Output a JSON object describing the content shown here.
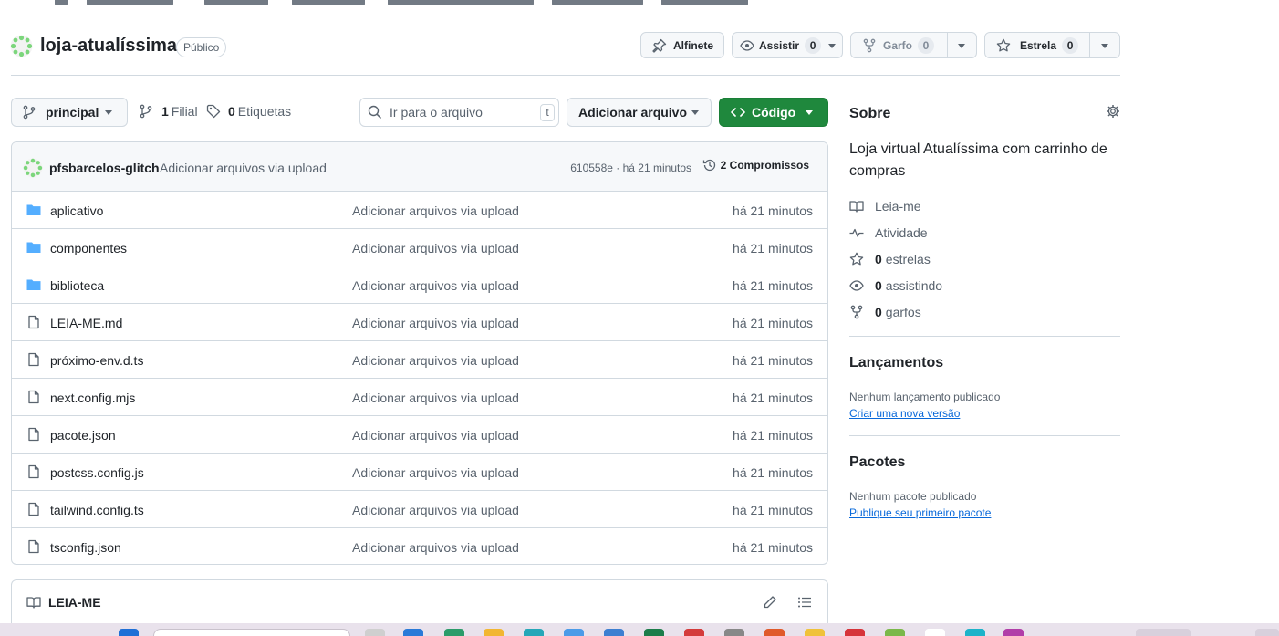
{
  "repo": {
    "name": "loja-atualíssima",
    "visibility": "Público"
  },
  "actions": {
    "pin_label": "Alfinete",
    "watch_label": "Assistir",
    "watch_count": "0",
    "fork_label": "Garfo",
    "fork_count": "0",
    "star_label": "Estrela",
    "star_count": "0"
  },
  "toolbar": {
    "branch": "principal",
    "branches_count": "1",
    "branches_label": "Filial",
    "tags_count": "0",
    "tags_label": "Etiquetas",
    "search_placeholder": "Ir para o arquivo",
    "search_kbd": "t",
    "add_file_label": "Adicionar arquivo",
    "code_label": "Código"
  },
  "commit": {
    "author": "pfsbarcelos-glitch",
    "message": "Adicionar arquivos via upload",
    "sha_time": "610558e · há 21 minutos",
    "count_label": "2 Compromissos"
  },
  "files": [
    {
      "type": "dir",
      "name": "aplicativo",
      "message": "Adicionar arquivos via upload",
      "time": "há 21 minutos"
    },
    {
      "type": "dir",
      "name": "componentes",
      "message": "Adicionar arquivos via upload",
      "time": "há 21 minutos"
    },
    {
      "type": "dir",
      "name": "biblioteca",
      "message": "Adicionar arquivos via upload",
      "time": "há 21 minutos"
    },
    {
      "type": "file",
      "name": "LEIA-ME.md",
      "message": "Adicionar arquivos via upload",
      "time": "há 21 minutos"
    },
    {
      "type": "file",
      "name": "próximo-env.d.ts",
      "message": "Adicionar arquivos via upload",
      "time": "há 21 minutos"
    },
    {
      "type": "file",
      "name": "next.config.mjs",
      "message": "Adicionar arquivos via upload",
      "time": "há 21 minutos"
    },
    {
      "type": "file",
      "name": "pacote.json",
      "message": "Adicionar arquivos via upload",
      "time": "há 21 minutos"
    },
    {
      "type": "file",
      "name": "postcss.config.js",
      "message": "Adicionar arquivos via upload",
      "time": "há 21 minutos"
    },
    {
      "type": "file",
      "name": "tailwind.config.ts",
      "message": "Adicionar arquivos via upload",
      "time": "há 21 minutos"
    },
    {
      "type": "file",
      "name": "tsconfig.json",
      "message": "Adicionar arquivos via upload",
      "time": "há 21 minutos"
    }
  ],
  "readme": {
    "title": "LEIA-ME"
  },
  "about": {
    "heading": "Sobre",
    "description": "Loja virtual Atualíssima com carrinho de compras",
    "readme_link": "Leia-me",
    "activity_link": "Atividade",
    "stars_count": "0",
    "stars_label": "estrelas",
    "watching_count": "0",
    "watching_label": "assistindo",
    "forks_count": "0",
    "forks_label": "garfos"
  },
  "releases": {
    "heading": "Lançamentos",
    "empty_text": "Nenhum lançamento publicado",
    "create_link": "Criar uma nova versão"
  },
  "packages": {
    "heading": "Pacotes",
    "empty_text": "Nenhum pacote publicado",
    "publish_link": "Publique seu primeiro pacote"
  },
  "colors": {
    "primary_green": "#1f883d",
    "folder_blue": "#54aeff",
    "link_blue": "#0969da",
    "muted_text": "#59636e",
    "border": "#d1d9e0"
  }
}
